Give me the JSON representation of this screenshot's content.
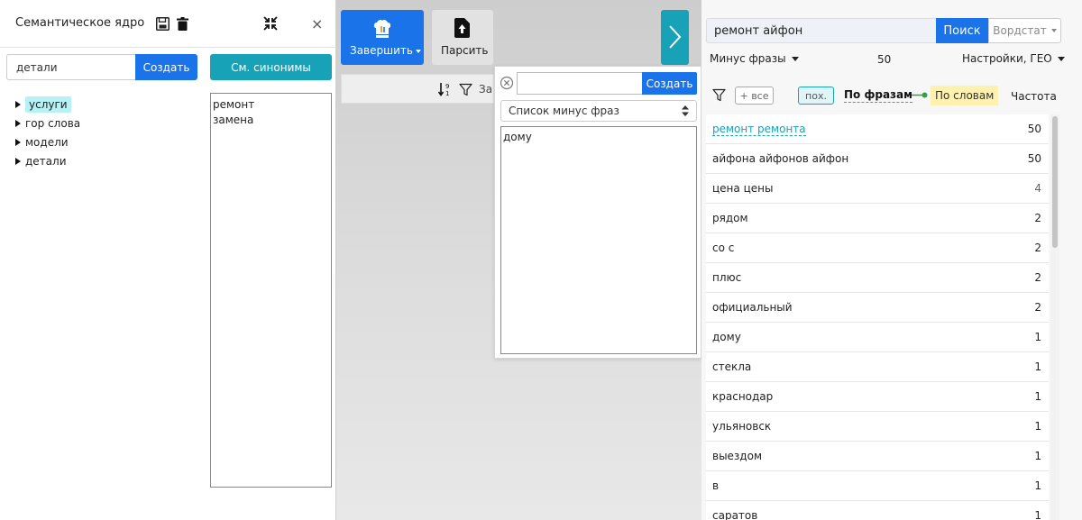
{
  "left_panel": {
    "title": "Семантическое ядро",
    "icons": {
      "save": "save-icon",
      "delete": "trash-icon",
      "collapse": "collapse-icon"
    },
    "close_label": "×",
    "group_input_value": "детали",
    "create_label": "Создать",
    "synonyms_label": "См. синонимы",
    "tree": [
      {
        "label": "услуги",
        "active": true
      },
      {
        "label": "гор слова",
        "active": false
      },
      {
        "label": "модели",
        "active": false
      },
      {
        "label": "детали",
        "active": false
      }
    ],
    "synonyms_text": [
      "ремонт",
      "замена"
    ]
  },
  "toolbar": {
    "finish_label": "Завершить",
    "parse_label": "Парсить",
    "strip_cut_text": "За"
  },
  "minus_popup": {
    "input_value": "",
    "create_label": "Создать",
    "list_select": "Список минус фраз",
    "text": "дому"
  },
  "right_panel": {
    "search_value": "ремонт айфон",
    "search_label": "Поиск",
    "wordstat_label": "Вордстат",
    "minus_phrases_label": "Минус фразы",
    "count": "50",
    "settings_label": "Настройки, ГЕО",
    "add_all_label": "+ все",
    "similar_label": "пох.",
    "by_phrases_label": "По фразам",
    "by_words_label": "По словам",
    "freq_label": "Частота",
    "phrases": [
      {
        "text": "ремонт ремонта",
        "count": "50",
        "link": true
      },
      {
        "text": "айфона айфонов айфон",
        "count": "50"
      },
      {
        "text": "цена цены",
        "count": "4",
        "muted": true
      },
      {
        "text": "рядом",
        "count": "2"
      },
      {
        "text": "со с",
        "count": "2"
      },
      {
        "text": "плюс",
        "count": "2"
      },
      {
        "text": "официальный",
        "count": "2"
      },
      {
        "text": "дому",
        "count": "1"
      },
      {
        "text": "стекла",
        "count": "1"
      },
      {
        "text": "краснодар",
        "count": "1"
      },
      {
        "text": "ульяновск",
        "count": "1"
      },
      {
        "text": "выездом",
        "count": "1"
      },
      {
        "text": "в",
        "count": "1"
      },
      {
        "text": "саратов",
        "count": "1"
      }
    ]
  },
  "colors": {
    "primary": "#1a73e8",
    "teal": "#17a2b8",
    "highlight": "#b6f2f4",
    "words_bg": "#fff2b0"
  }
}
